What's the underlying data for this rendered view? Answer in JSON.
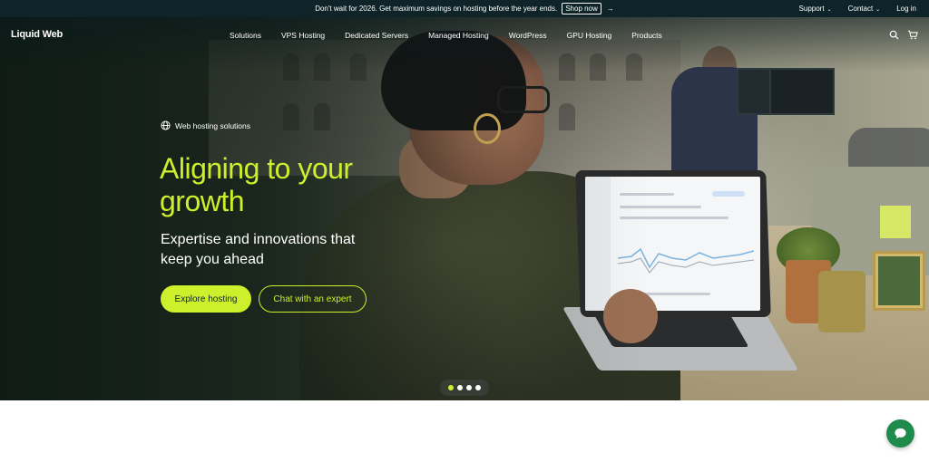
{
  "promo": {
    "message": "Don't wait for 2026. Get maximum savings on hosting before the year ends.",
    "cta": "Shop now",
    "arrow": "→",
    "links": {
      "support": "Support",
      "contact": "Contact",
      "login": "Log in"
    }
  },
  "nav": {
    "logo": "Liquid Web",
    "items": [
      "Solutions",
      "VPS Hosting",
      "Dedicated Servers",
      "Managed Hosting",
      "WordPress",
      "GPU Hosting",
      "Products"
    ],
    "icons": [
      "search-icon",
      "cart-icon"
    ]
  },
  "hero": {
    "eyebrow": "Web hosting solutions",
    "headline_line1": "Aligning to your",
    "headline_line2": "growth",
    "subhead_line1": "Expertise and innovations that",
    "subhead_line2": "keep you ahead",
    "primary_cta": "Explore hosting",
    "secondary_cta": "Chat with an expert",
    "carousel": {
      "slides": 4,
      "active_index": 0
    }
  },
  "colors": {
    "accent": "#cdef2c",
    "dark": "#0e2428",
    "chat": "#1e8a4c"
  },
  "chat": {
    "icon": "chat-bubble-icon"
  }
}
